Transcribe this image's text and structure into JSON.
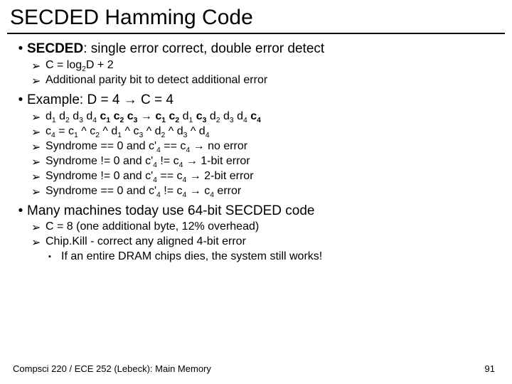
{
  "title": "SECDED Hamming Code",
  "p1_strong": "SECDED",
  "p1_rest": ": single error correct, double error detect",
  "s1a_a": "C = log",
  "s1a_sub": "2",
  "s1a_b": "D + 2",
  "s1b": "Additional parity bit to detect additional error",
  "p2": "Example: D = 4 → C = 4",
  "seq1": [
    "d",
    "1",
    " d",
    "2",
    " d",
    "3",
    " d",
    "4",
    " "
  ],
  "seq1b": [
    "c",
    "1",
    " c",
    "2",
    " c",
    "3"
  ],
  "seq_arrow": " → ",
  "seq2b": [
    "c",
    "1",
    " c",
    "2"
  ],
  "seq2m": [
    " d",
    "1",
    " "
  ],
  "seq2b2": [
    "c",
    "3"
  ],
  "seq2m2": [
    " d",
    "2",
    " d",
    "3",
    " d",
    "4",
    " "
  ],
  "seq2b3": [
    "c",
    "4"
  ],
  "s2b": "c<sub>4</sub> = c<sub>1</sub> ^ c<sub>2</sub> ^ d<sub>1</sub> ^ c<sub>3</sub> ^ d<sub>2</sub> ^ d<sub>3</sub> ^ d<sub>4</sub>",
  "s2c": "Syndrome == 0 and c'<sub>4</sub> == c<sub>4</sub> → no error",
  "s2d": "Syndrome != 0 and c'<sub>4</sub> != c<sub>4</sub> → 1-bit error",
  "s2e": "Syndrome != 0 and c'<sub>4</sub> == c<sub>4</sub> → 2-bit error",
  "s2f": "Syndrome == 0 and c'<sub>4</sub> != c<sub>4</sub> → c<sub>4</sub> error",
  "p3": "Many machines today use 64-bit SECDED code",
  "s3a": "C = 8 (one additional byte, 12% overhead)",
  "s3b": "Chip.Kill - correct any aligned 4-bit error",
  "s3c": "If an entire DRAM chips dies, the system still works!",
  "footer_l": "Compsci 220 / ECE 252 (Lebeck): Main Memory",
  "footer_r": "91",
  "dot": "•",
  "arr": "➢",
  "sq": "▪"
}
